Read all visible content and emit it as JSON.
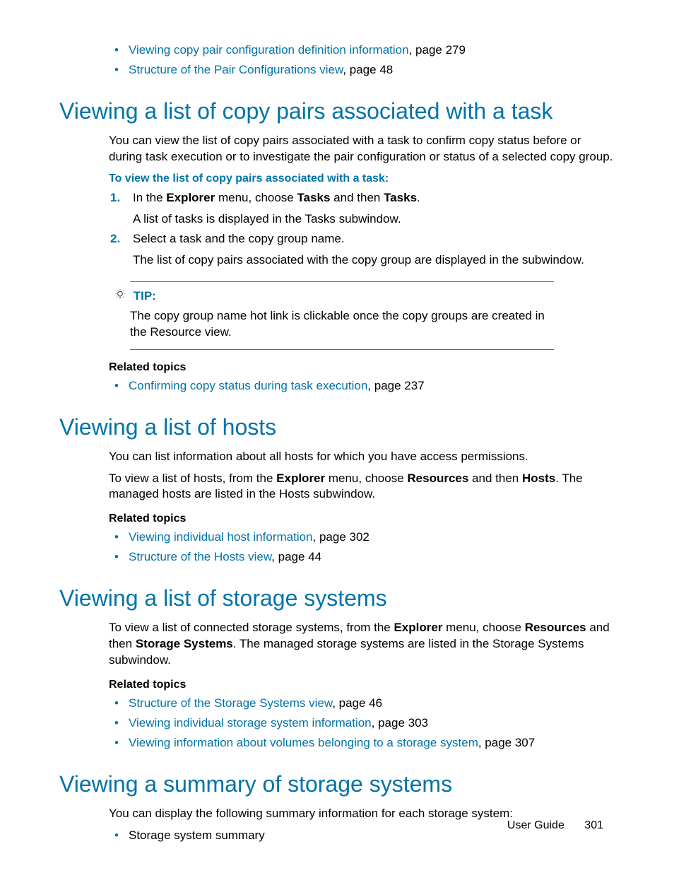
{
  "top_related": [
    {
      "link": "Viewing copy pair configuration definition information",
      "page": ", page 279"
    },
    {
      "link": "Structure of the Pair Configurations view",
      "page": ", page 48"
    }
  ],
  "s1": {
    "title": "Viewing a list of copy pairs associated with a task",
    "p1": "You can view the list of copy pairs associated with a task to confirm copy status before or during task execution or to investigate the pair configuration or status of a selected copy group.",
    "proc_head": "To view the list of copy pairs associated with a task:",
    "step1_a": "In the ",
    "step1_b": "Explorer",
    "step1_c": " menu, choose ",
    "step1_d": "Tasks",
    "step1_e": " and then ",
    "step1_f": "Tasks",
    "step1_g": ".",
    "step1_body": "A list of tasks is displayed in the Tasks subwindow.",
    "step2_a": "Select a task and the copy group name.",
    "step2_body": "The list of copy pairs associated with the copy group are displayed in the subwindow.",
    "tip_label": "TIP:",
    "tip_text": "The copy group name hot link is clickable once the copy groups are created in the Resource view.",
    "related_head": "Related topics",
    "related": [
      {
        "link": "Confirming copy status during task execution",
        "page": ", page 237"
      }
    ]
  },
  "s2": {
    "title": "Viewing a list of hosts",
    "p1": "You can list information about all hosts for which you have access permissions.",
    "p2_a": "To view a list of hosts, from the ",
    "p2_b": "Explorer",
    "p2_c": " menu, choose ",
    "p2_d": "Resources",
    "p2_e": " and then ",
    "p2_f": "Hosts",
    "p2_g": ". The managed hosts are listed in the Hosts subwindow.",
    "related_head": "Related topics",
    "related": [
      {
        "link": "Viewing individual host information",
        "page": ", page 302"
      },
      {
        "link": "Structure of the Hosts view",
        "page": ", page 44"
      }
    ]
  },
  "s3": {
    "title": "Viewing a list of storage systems",
    "p1_a": "To view a list of connected storage systems, from the ",
    "p1_b": "Explorer",
    "p1_c": " menu, choose ",
    "p1_d": "Resources",
    "p1_e": " and then ",
    "p1_f": "Storage Systems",
    "p1_g": ". The managed storage systems are listed in the Storage Systems subwindow.",
    "related_head": "Related topics",
    "related": [
      {
        "link": "Structure of the Storage Systems view",
        "page": ", page 46"
      },
      {
        "link": "Viewing individual storage system information",
        "page": ", page 303"
      },
      {
        "link": "Viewing information about volumes belonging to a storage system",
        "page": ", page 307"
      }
    ]
  },
  "s4": {
    "title": "Viewing a summary of storage systems",
    "p1": "You can display the following summary information for each storage system:",
    "bullets": [
      {
        "text": "Storage system summary"
      }
    ]
  },
  "footer": {
    "label": "User Guide",
    "page": "301"
  }
}
